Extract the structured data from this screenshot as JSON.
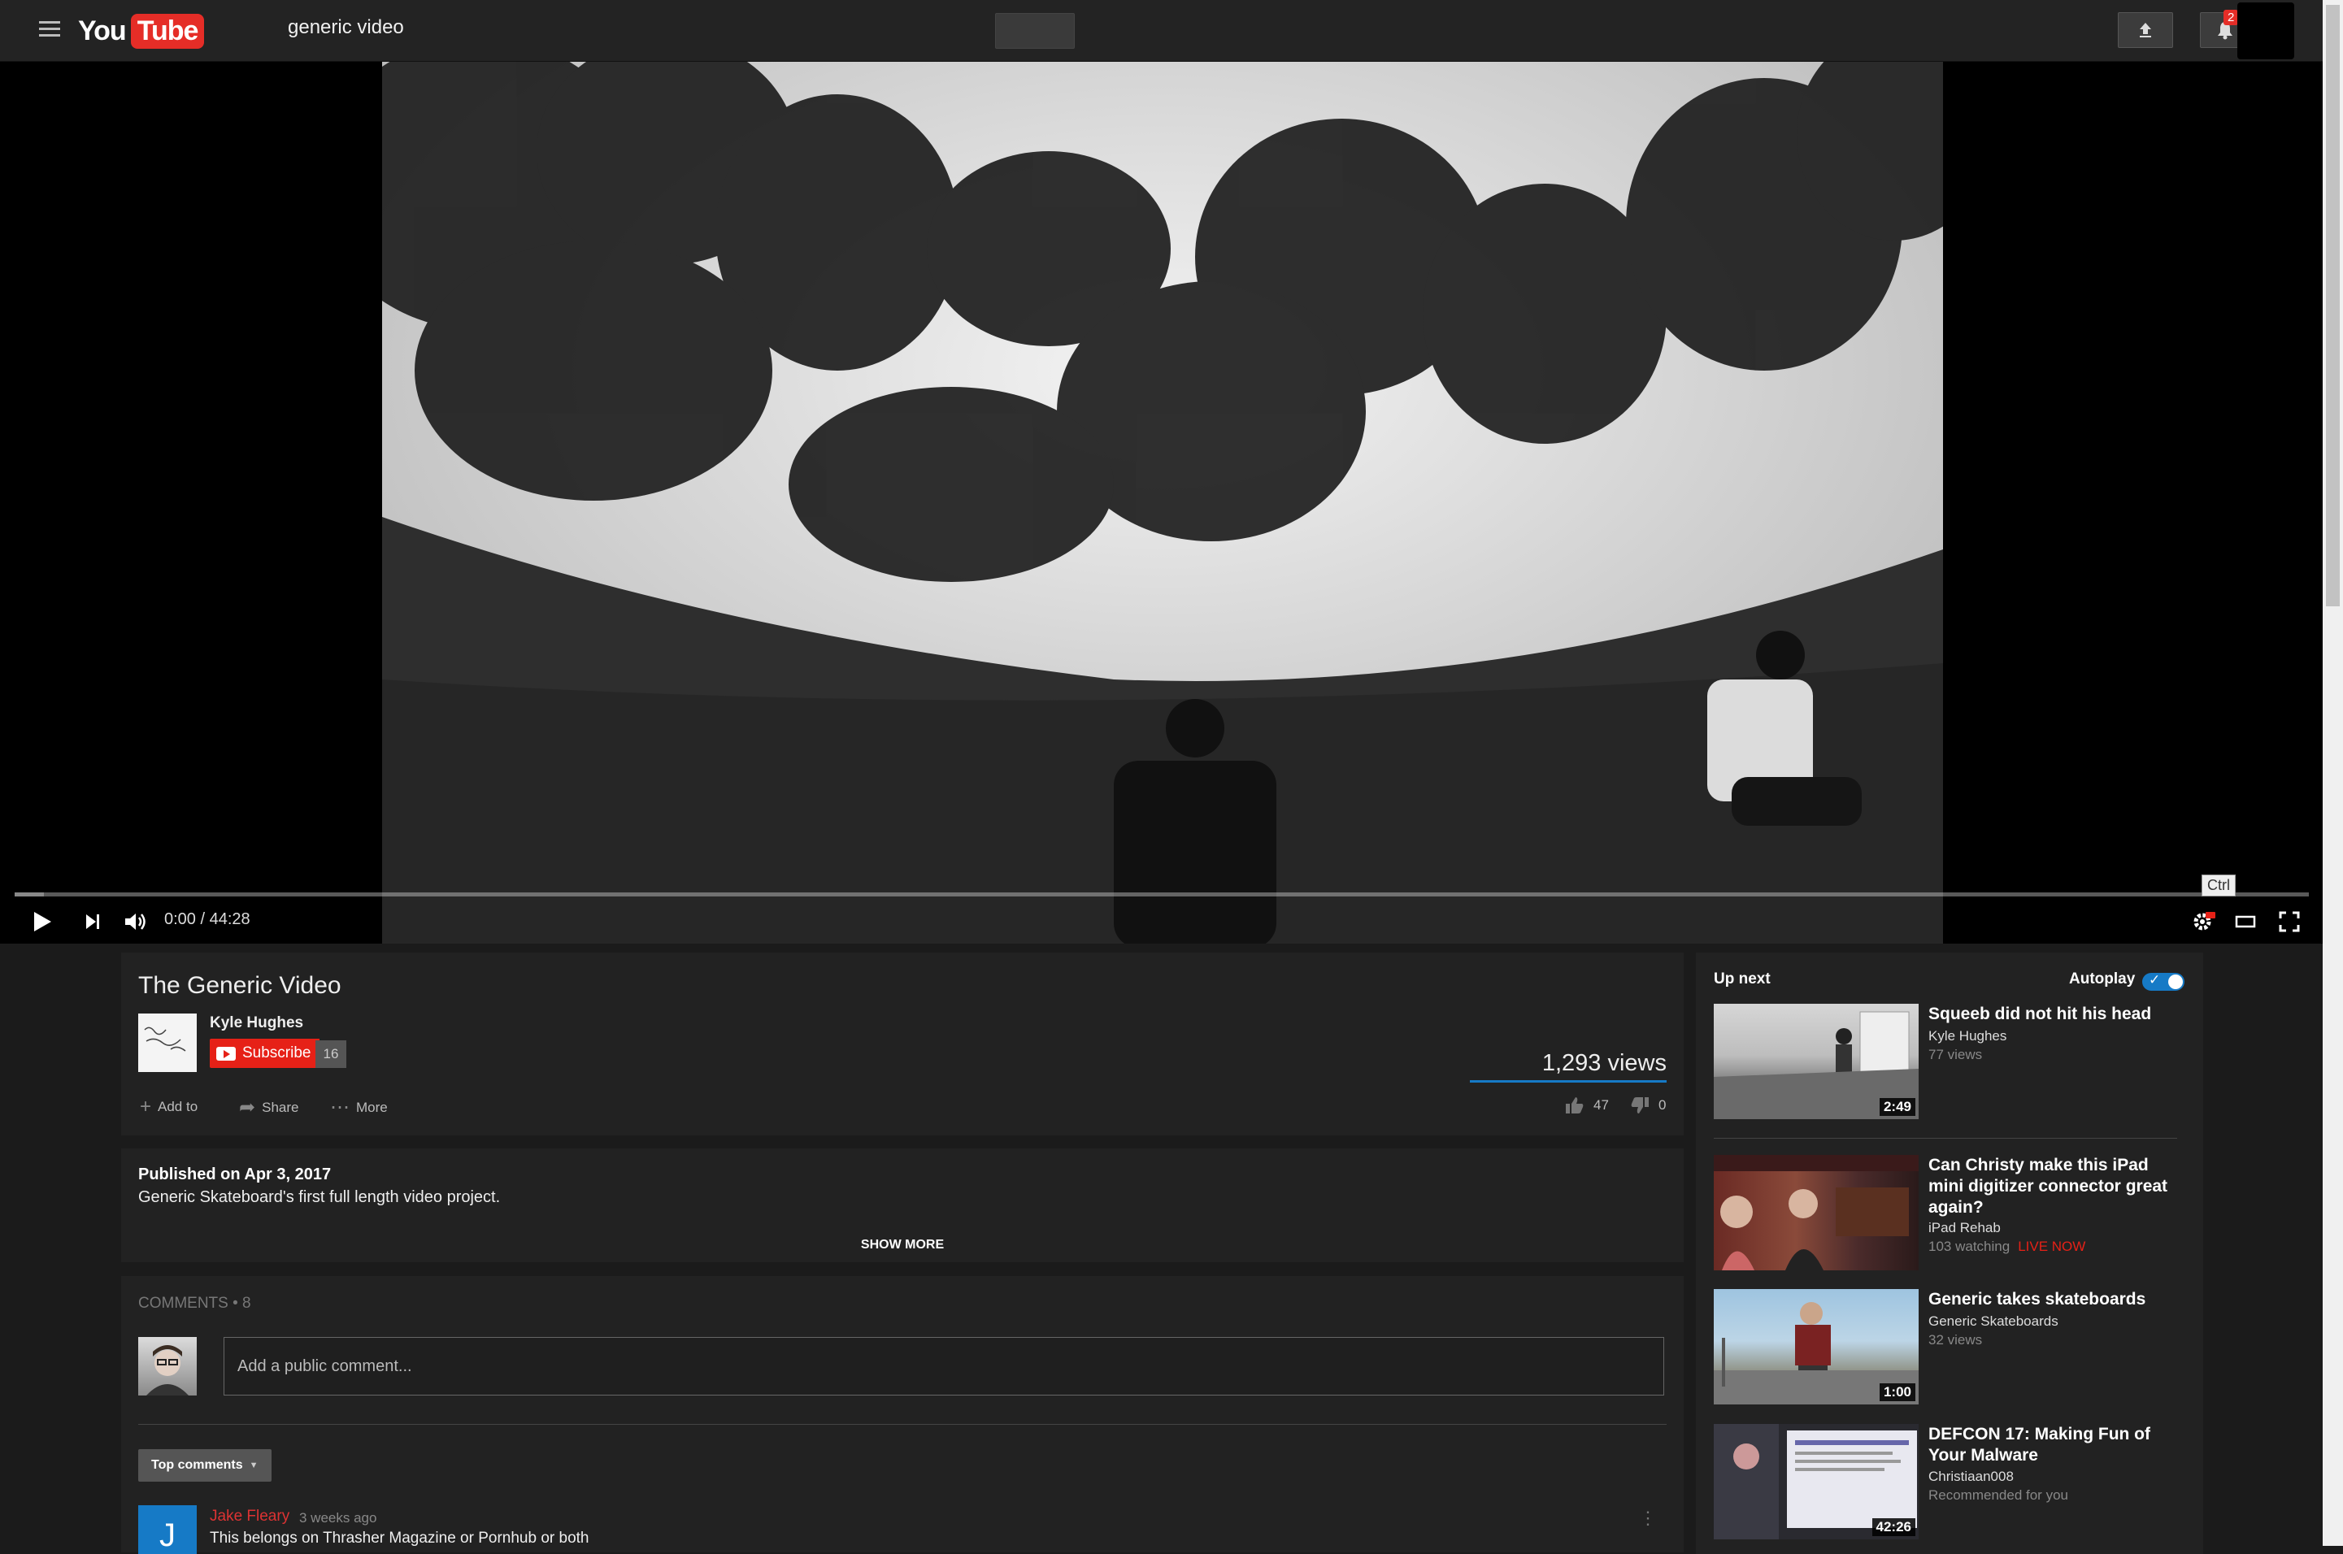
{
  "header": {
    "logo_text": "YouTube",
    "search_query": "generic video",
    "notification_count": "2"
  },
  "player": {
    "time_display": "0:00 / 44:28",
    "progress": 0.0,
    "tooltip": "Ctrl"
  },
  "video": {
    "title": "The Generic Video",
    "channel_name": "Kyle Hughes",
    "subscribe_label": "Subscribe",
    "subscriber_count": "16",
    "views": "1,293 views",
    "actions": {
      "add_to": "Add to",
      "share": "Share",
      "more": "More"
    },
    "likes": "47",
    "dislikes": "0"
  },
  "description": {
    "published": "Published on Apr 3, 2017",
    "text": "Generic Skateboard's first full length video project.",
    "show_more": "SHOW MORE"
  },
  "comments": {
    "header": "COMMENTS • 8",
    "placeholder": "Add a public comment...",
    "sort_label": "Top comments",
    "items": [
      {
        "avatar_letter": "J",
        "author": "Jake Fleary",
        "time": "3 weeks ago",
        "text": "This belongs on Thrasher Magazine or Pornhub or both"
      }
    ]
  },
  "sidebar": {
    "up_next_label": "Up next",
    "autoplay_label": "Autoplay",
    "autoplay_on": true,
    "videos": [
      {
        "title": "Squeeb did not hit his head",
        "channel": "Kyle Hughes",
        "meta": "77 views",
        "duration": "2:49"
      },
      {
        "title": "Can Christy make this iPad mini digitizer connector great again?",
        "channel": "iPad Rehab",
        "meta": "103 watching",
        "live": "LIVE NOW",
        "duration": ""
      },
      {
        "title": "Generic takes skateboards",
        "channel": "Generic Skateboards",
        "meta": "32 views",
        "duration": "1:00"
      },
      {
        "title": "DEFCON 17: Making Fun of Your Malware",
        "channel": "Christiaan008",
        "meta": "Recommended for you",
        "duration": "42:26"
      }
    ]
  },
  "colors": {
    "accent": "#167ac6",
    "brand": "#e62117",
    "background": "#1b1b1b",
    "card": "#222222"
  }
}
